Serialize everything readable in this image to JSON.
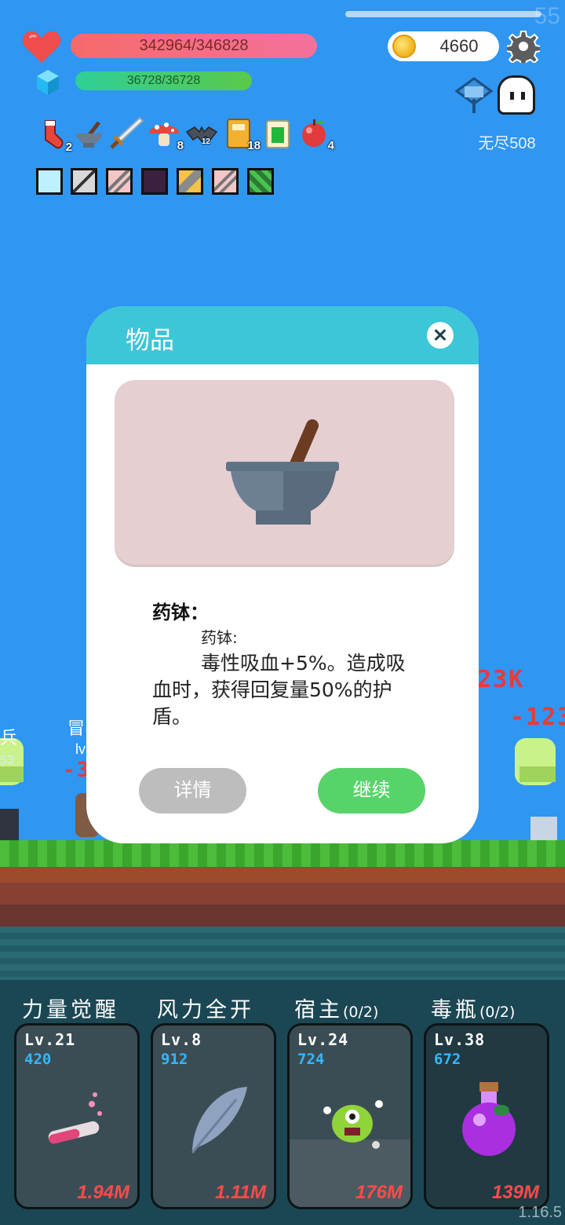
{
  "hud": {
    "fps": "55",
    "hp": "342964/346828",
    "mp": "36728/36728",
    "gold": "4660",
    "mode_label": "无尽508"
  },
  "items": [
    {
      "icon": "sock-icon",
      "count": "2"
    },
    {
      "icon": "mortar-icon",
      "count": ""
    },
    {
      "icon": "sword-icon",
      "count": ""
    },
    {
      "icon": "mushroom-icon",
      "count": "8"
    },
    {
      "icon": "bat-icon",
      "count": "12"
    },
    {
      "icon": "book-icon",
      "count": "18"
    },
    {
      "icon": "card-icon",
      "count": ""
    },
    {
      "icon": "apple-icon",
      "count": "4"
    }
  ],
  "skills": [
    {
      "icon": "lightbulb-skill-icon",
      "color": "#bff0ff"
    },
    {
      "icon": "blade-skill-icon",
      "color": "#d9d9d9"
    },
    {
      "icon": "slash-skill-icon",
      "color": "#f5c6c6"
    },
    {
      "icon": "shadow-skill-icon",
      "color": "#3b2040"
    },
    {
      "icon": "shield-skill-icon",
      "color": "#f3c34a"
    },
    {
      "icon": "slash2-skill-icon",
      "color": "#f5c6c6"
    },
    {
      "icon": "poison-skill-icon",
      "color": "#2c7a34"
    }
  ],
  "scene": {
    "damage_1": "23K",
    "damage_2": "-123",
    "damage_3": "-3",
    "left_char": "兵",
    "left_num": "53",
    "adventurer": "冒",
    "adventurer_lv": "lv"
  },
  "dialog": {
    "title": "物品",
    "item_name": "药钵：",
    "item_sub": "药钵:",
    "item_desc": "毒性吸血+5%。造成吸血时，获得回复量50%的护盾。",
    "detail_label": "详情",
    "continue_label": "继续"
  },
  "cards": [
    {
      "title": "力量觉醒",
      "suffix": "",
      "lv": "Lv.21",
      "pts": "420",
      "dps": "1.94M",
      "art": "potion-tube-icon"
    },
    {
      "title": "风力全开",
      "suffix": "",
      "lv": "Lv.8",
      "pts": "912",
      "dps": "1.11M",
      "art": "feather-icon"
    },
    {
      "title": "宿主",
      "suffix": "(0/2)",
      "lv": "Lv.24",
      "pts": "724",
      "dps": "176M",
      "art": "virus-monster-icon"
    },
    {
      "title": "毒瓶",
      "suffix": "(0/2)",
      "lv": "Lv.38",
      "pts": "672",
      "dps": "139M",
      "art": "poison-flask-icon"
    }
  ],
  "version": "1.16.5",
  "colors": {
    "sky": "#2f96f2",
    "dialog_header": "#3cc6d7",
    "continue_button": "#57d36a",
    "detail_button": "#bdbdbd",
    "hp_bar": "#f76a6a",
    "mp_bar": "#2fcf98",
    "damage": "#e83a3a"
  }
}
